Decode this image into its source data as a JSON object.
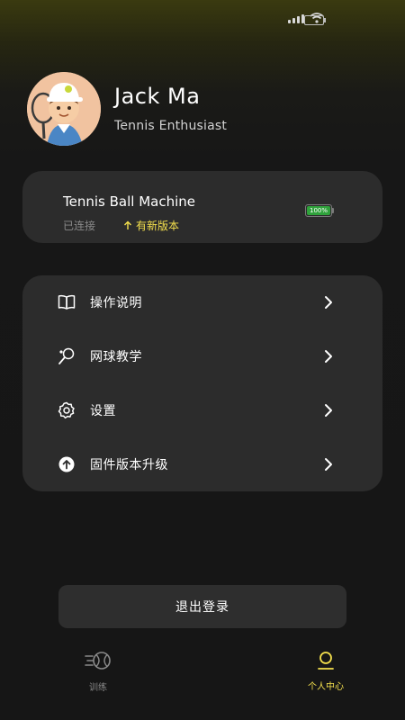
{
  "profile": {
    "name": "Jack Ma",
    "subtitle": "Tennis Enthusiast"
  },
  "device": {
    "name": "Tennis Ball Machine",
    "status": "已连接",
    "update_label": "有新版本",
    "battery_level_text": "100%",
    "battery_level": 1.0
  },
  "menu": {
    "items": [
      {
        "label": "操作说明",
        "icon": "book-icon"
      },
      {
        "label": "网球教学",
        "icon": "tennis-racket-icon"
      },
      {
        "label": "设置",
        "icon": "gear-icon"
      },
      {
        "label": "固件版本升级",
        "icon": "upload-arrow-icon"
      }
    ]
  },
  "logout_label": "退出登录",
  "tabbar": {
    "tabs": [
      {
        "label": "训练",
        "icon": "training-ball-icon",
        "active": false
      },
      {
        "label": "个人中心",
        "icon": "person-icon",
        "active": true
      }
    ]
  },
  "colors": {
    "accent": "#f4e04d",
    "card": "#2c2c2c",
    "battery_green": "#2fa23b"
  }
}
